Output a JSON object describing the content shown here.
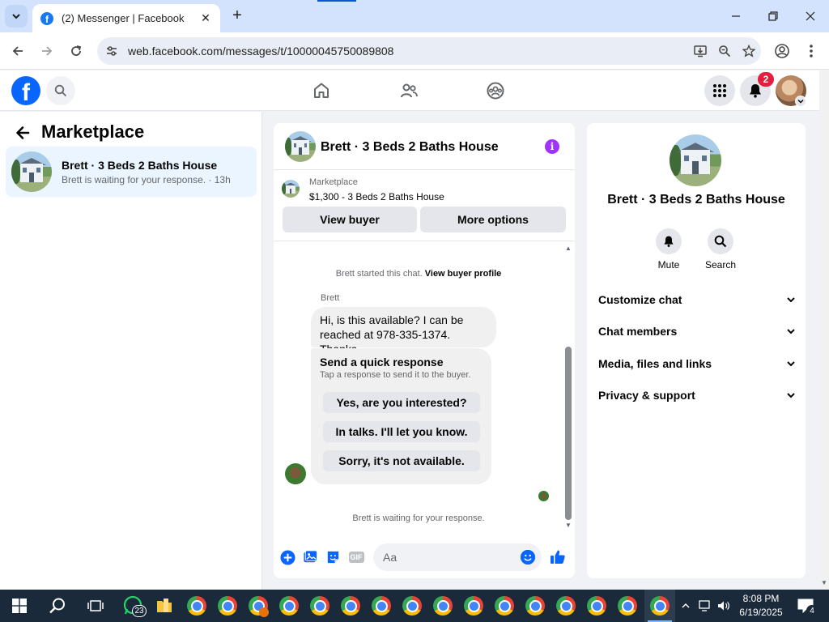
{
  "browser": {
    "tab_title": "(2) Messenger | Facebook",
    "url": "web.facebook.com/messages/t/10000045750089808"
  },
  "fb_header": {
    "logo_letter": "f",
    "notification_count": "2"
  },
  "left_panel": {
    "title": "Marketplace",
    "conversations": [
      {
        "name": "Brett · 3 Beds 2 Baths House",
        "preview": "Brett is waiting for your response. · 13h"
      }
    ]
  },
  "chat": {
    "title": "Brett · 3 Beds 2 Baths House",
    "listing_label": "Marketplace",
    "listing_price_title": "$1,300 - 3 Beds 2 Baths House",
    "view_buyer_label": "View buyer",
    "more_options_label": "More options",
    "started_text": "Brett started this chat.",
    "view_profile_link": "View buyer profile",
    "sender_name": "Brett",
    "message_text": "Hi, is this available? I can be reached at 978-335-1374. Thanks.",
    "quick_response_title": "Send a quick response",
    "quick_response_subtitle": "Tap a response to send it to the buyer.",
    "quick_responses": [
      "Yes, are you interested?",
      "In talks. I'll let you know.",
      "Sorry, it's not available."
    ],
    "waiting_text": "Brett is waiting for your response.",
    "composer_placeholder": "Aa",
    "gif_label": "GIF"
  },
  "info_panel": {
    "title": "Brett · 3 Beds 2 Baths House",
    "mute_label": "Mute",
    "search_label": "Search",
    "sections": [
      "Customize chat",
      "Chat members",
      "Media, files and links",
      "Privacy & support"
    ]
  },
  "taskbar": {
    "whatsapp_badge": "23",
    "time": "8:08 PM",
    "date": "6/19/2025",
    "notification_count": "4"
  },
  "colors": {
    "facebook_blue": "#0866ff",
    "info_purple": "#a033ff",
    "badge_red": "#e41e3f",
    "selected_conversation": "#ebf5ff"
  }
}
